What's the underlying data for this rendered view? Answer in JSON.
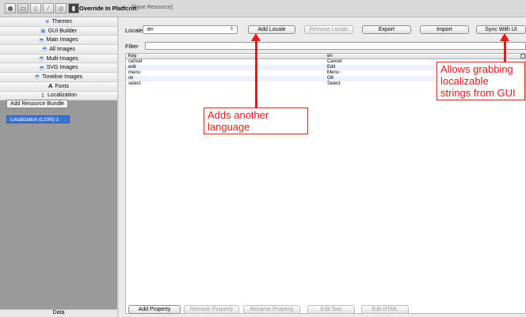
{
  "toolbar": {
    "icons": [
      "record-icon",
      "folder-icon",
      "document-icon",
      "tool-icon",
      "settings-icon",
      "phone-icon"
    ],
    "override_label": "Override In Platform:",
    "override_value": "[Base Resource]"
  },
  "sidebar": {
    "items": [
      {
        "label": "Themes",
        "icon": "themes-icon"
      },
      {
        "label": "GUI Builder",
        "icon": "gui-builder-icon"
      },
      {
        "label": "Main Images",
        "icon": "image-icon"
      },
      {
        "label": "All Images",
        "icon": "image-icon"
      },
      {
        "label": "Multi-Images",
        "icon": "image-icon"
      },
      {
        "label": "SVG Images",
        "icon": "image-icon"
      },
      {
        "label": "Timeline Images",
        "icon": "image-icon"
      },
      {
        "label": "Fonts",
        "icon": "font-icon"
      },
      {
        "label": "Localization",
        "icon": "localization-icon"
      }
    ],
    "add_bundle_label": "Add Resource Bundle",
    "bundle_item": "Localization (L10N) 1",
    "bottom_item": "Data"
  },
  "main": {
    "locale_label": "Locale",
    "locale_value": "en",
    "buttons": {
      "add_locale": "Add Locale",
      "remove_locale": "Remove Locale",
      "export": "Export",
      "import": "Import",
      "sync": "Sync With UI"
    },
    "filter_label": "Filter",
    "filter_value": "",
    "table": {
      "headers": [
        "Key",
        "en"
      ],
      "rows": [
        [
          "cancel",
          "Cancel"
        ],
        [
          "edit",
          "Edit"
        ],
        [
          "menu",
          "Menu"
        ],
        [
          "ok",
          "OK"
        ],
        [
          "select",
          "Select"
        ]
      ]
    },
    "bottom_buttons": {
      "add_property": "Add Property",
      "remove_property": "Remove Property",
      "rename_property": "Rename Property",
      "edit_text": "Edit Text",
      "edit_html": "Edit HTML"
    }
  },
  "annotations": {
    "add_language": "Adds another language",
    "grab_strings": "Allows grabbing localizable strings from GUI"
  },
  "colors": {
    "annotation": "#e61a1a",
    "selection": "#3b74d1"
  }
}
